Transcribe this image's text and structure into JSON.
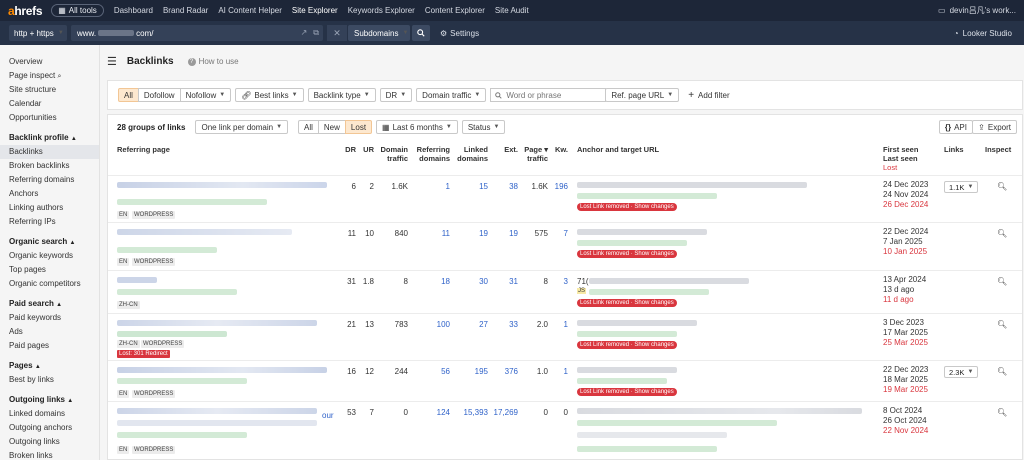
{
  "topnav": {
    "logo_a": "a",
    "logo_rest": "hrefs",
    "all_tools": "All tools",
    "links": [
      "Dashboard",
      "Brand Radar",
      "AI Content Helper",
      "Site Explorer",
      "Keywords Explorer",
      "Content Explorer",
      "Site Audit"
    ],
    "active_link": "Site Explorer",
    "account": "devin吕凡's work..."
  },
  "urlbar": {
    "protocol": "http + https",
    "url_prefix": "www.",
    "url_suffix": "com/",
    "mode": "Subdomains",
    "settings": "Settings",
    "looker": "Looker Studio"
  },
  "sidebar": {
    "top": [
      "Overview",
      "Page inspect",
      "Site structure",
      "Calendar",
      "Opportunities"
    ],
    "sections": [
      {
        "title": "Backlink profile",
        "items": [
          "Backlinks",
          "Broken backlinks",
          "Referring domains",
          "Anchors",
          "Linking authors",
          "Referring IPs"
        ]
      },
      {
        "title": "Organic search",
        "items": [
          "Organic keywords",
          "Top pages",
          "Organic competitors"
        ]
      },
      {
        "title": "Paid search",
        "items": [
          "Paid keywords",
          "Ads",
          "Paid pages"
        ]
      },
      {
        "title": "Pages",
        "items": [
          "Best by links"
        ]
      },
      {
        "title": "Outgoing links",
        "items": [
          "Linked domains",
          "Outgoing anchors",
          "Outgoing links",
          "Broken links"
        ]
      }
    ],
    "active": "Backlinks"
  },
  "main": {
    "title": "Backlinks",
    "how_to": "How to use"
  },
  "filters": {
    "type_tabs": [
      "All",
      "Dofollow",
      "Nofollow"
    ],
    "type_selected": "All",
    "best_links": "Best links",
    "backlink_type": "Backlink type",
    "dr": "DR",
    "domain_traffic": "Domain traffic",
    "keyword_placeholder": "Word or phrase",
    "ref_page_url": "Ref. page URL",
    "add_filter": "Add filter"
  },
  "table": {
    "groups_label": "28 groups of links",
    "grouping": "One link per domain",
    "status_tabs": [
      "All",
      "New",
      "Lost"
    ],
    "status_selected": "Lost",
    "period": "Last 6 months",
    "status_dropdown": "Status",
    "api": "API",
    "export": "Export",
    "headers": {
      "referring_page": "Referring page",
      "dr": "DR",
      "ur": "UR",
      "domain_traffic": [
        "Domain",
        "traffic"
      ],
      "referring_domains": [
        "Referring",
        "domains"
      ],
      "linked_domains": [
        "Linked",
        "domains"
      ],
      "ext": "Ext.",
      "page_traffic": [
        "Page ▾",
        "traffic"
      ],
      "kw": "Kw.",
      "anchor": "Anchor and target URL",
      "first_seen": "First seen",
      "last_seen": "Last seen",
      "lost": "Lost",
      "links": "Links",
      "inspect": "Inspect"
    },
    "rows": [
      {
        "tags": [
          "EN",
          "WORDPRESS"
        ],
        "dr": "6",
        "ur": "2",
        "domain_traffic": "1.6K",
        "ref_domains": "1",
        "linked_domains": "15",
        "ext": "38",
        "page_traffic": "1.6K",
        "kw": "196",
        "lost_label": "Lost  Link removed · Show changes",
        "first": "24 Dec 2023",
        "last": "24 Nov 2024",
        "lost": "26 Dec 2024",
        "links": "1.1K"
      },
      {
        "tags": [
          "EN",
          "WORDPRESS"
        ],
        "dr": "11",
        "ur": "10",
        "domain_traffic": "840",
        "ref_domains": "11",
        "linked_domains": "19",
        "ext": "19",
        "page_traffic": "575",
        "kw": "7",
        "lost_label": "Lost  Link removed · Show changes",
        "first": "22 Dec 2024",
        "last": "7 Jan 2025",
        "lost": "10 Jan 2025",
        "links": ""
      },
      {
        "tags": [
          "ZH-CN"
        ],
        "dr": "31",
        "ur": "1.8",
        "domain_traffic": "8",
        "ref_domains": "18",
        "linked_domains": "30",
        "ext": "31",
        "page_traffic": "8",
        "kw": "3",
        "anchor_prefix": "71(",
        "anchor_js": "JS",
        "lost_label": "Lost  Link removed · Show changes",
        "first": "13 Apr 2024",
        "last": "13 d ago",
        "lost": "11 d ago",
        "links": ""
      },
      {
        "tags": [
          "ZH-CN",
          "WORDPRESS"
        ],
        "redirect": "Lost: 301 Redirect",
        "dr": "21",
        "ur": "13",
        "domain_traffic": "783",
        "ref_domains": "100",
        "linked_domains": "27",
        "ext": "33",
        "page_traffic": "2.0",
        "kw": "1",
        "lost_label": "Lost  Link removed · Show changes",
        "first": "3 Dec 2023",
        "last": "17 Mar 2025",
        "lost": "25 Mar 2025",
        "links": ""
      },
      {
        "tags": [
          "EN",
          "WORDPRESS"
        ],
        "dr": "16",
        "ur": "12",
        "domain_traffic": "244",
        "ref_domains": "56",
        "linked_domains": "195",
        "ext": "376",
        "page_traffic": "1.0",
        "kw": "1",
        "lost_label": "Lost  Link removed · Show changes",
        "first": "22 Dec 2023",
        "last": "18 Mar 2025",
        "lost": "19 Mar 2025",
        "links": "2.3K"
      },
      {
        "tags": [
          "EN",
          "WORDPRESS"
        ],
        "ref_suffix": "our",
        "dr": "53",
        "ur": "7",
        "domain_traffic": "0",
        "ref_domains": "124",
        "linked_domains": "15,393",
        "ext": "17,269",
        "page_traffic": "0",
        "kw": "0",
        "lost_label": "",
        "first": "8 Oct 2024",
        "last": "26 Oct 2024",
        "lost": "22 Nov 2024",
        "links": ""
      }
    ]
  },
  "colors": {
    "nav_bg": "#1d2638",
    "accent_orange": "#ff8a00",
    "link_blue": "#2f62c9",
    "lost_red": "#d9363e",
    "selected_tab": "#fde8cf"
  }
}
